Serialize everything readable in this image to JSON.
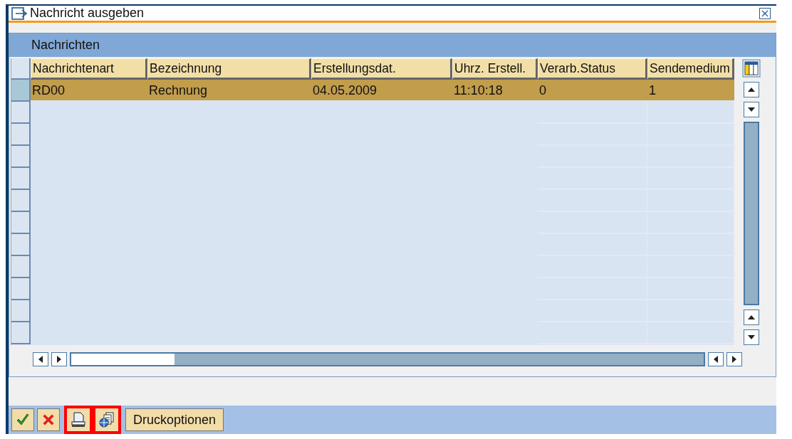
{
  "window": {
    "title": "Nachricht ausgeben"
  },
  "table": {
    "title": "Nachrichten",
    "columns": [
      "Nachrichtenart",
      "Bezeichnung",
      "Erstellungsdat.",
      "Uhrz. Erstell.",
      "Verarb.Status",
      "Sendemedium"
    ],
    "rows": [
      {
        "selected": true,
        "cells": [
          "RD00",
          "Rechnung",
          "04.05.2009",
          "11:10:18",
          "0",
          "1"
        ]
      }
    ]
  },
  "toolbar": [
    {
      "kind": "confirm",
      "highlighted": false
    },
    {
      "kind": "cancel",
      "highlighted": false
    },
    {
      "kind": "print",
      "highlighted": true
    },
    {
      "kind": "preview",
      "highlighted": true
    },
    {
      "kind": "text",
      "label": "Druckoptionen",
      "highlighted": false
    }
  ]
}
